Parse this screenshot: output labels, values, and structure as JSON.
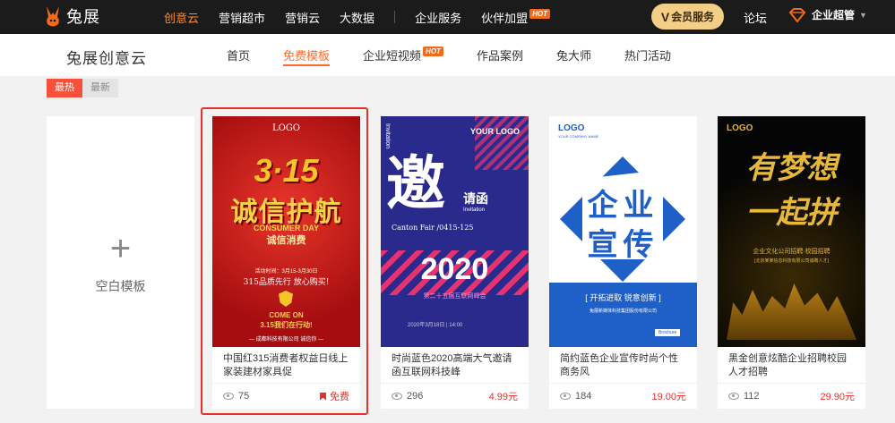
{
  "topbar": {
    "logo_text": "兔展",
    "nav": [
      {
        "label": "创意云",
        "active": true
      },
      {
        "label": "营销超市"
      },
      {
        "label": "营销云"
      },
      {
        "label": "大数据"
      }
    ],
    "nav2": [
      {
        "label": "企业服务"
      },
      {
        "label": "伙伴加盟",
        "hot": "HOT"
      }
    ],
    "vip_label": "会员服务",
    "vip_prefix": "V",
    "forum": "论坛",
    "enterprise": "企业超管"
  },
  "subbar": {
    "brand": "兔展创意云",
    "nav": [
      {
        "label": "首页"
      },
      {
        "label": "免费模板",
        "active": true
      },
      {
        "label": "企业短视频",
        "hot": "HOT"
      },
      {
        "label": "作品案例"
      },
      {
        "label": "兔大师"
      },
      {
        "label": "热门活动"
      }
    ]
  },
  "filters": [
    "最热",
    "最新"
  ],
  "blank_card": {
    "label": "空白模板"
  },
  "cards": [
    {
      "title": "中国红315消费者权益日线上家装建材家具促",
      "views": "75",
      "price": "免费",
      "free": true
    },
    {
      "title": "时尚蓝色2020高端大气邀请函互联网科技峰",
      "views": "296",
      "price": "4.99元"
    },
    {
      "title": "简约蓝色企业宣传时尚个性商务风",
      "views": "184",
      "price": "19.00元"
    },
    {
      "title": "黑金创意炫酷企业招聘校园人才招聘",
      "views": "112",
      "price": "29.90元"
    }
  ],
  "thumbs": {
    "t1": {
      "logo": "LOGO",
      "big": "3·15",
      "headline": "诚信护航",
      "sub": "CONSUMER DAY",
      "sub2": "诚信消费",
      "date": "活动时间：3月15-3月30日",
      "slogan": "315品质先行 放心购买!",
      "badge": "COME ON",
      "badge2": "3.15我们在行动!",
      "footer": "— 成都科技有限公司 诚信你 —"
    },
    "t2": {
      "label": "Invitation",
      "logo": "YOUR LOGO",
      "big": "邀",
      "small": "请函",
      "inv": "Invitation",
      "line": "Canton Fair /0415-125",
      "year": "2020",
      "strip": "第二十五届互联网峰会",
      "info": "2020年3月18日 | 14:00"
    },
    "t3": {
      "logo": "LOGO",
      "logo_sub": "YOUR COMPANY NAME",
      "word1": "企业",
      "word2": "宣传",
      "slogan": "[ 开拓进取 锐意创新 ]",
      "company": "兔展新媒体科技集团股份有限公司",
      "btn": "Brochure"
    },
    "t4": {
      "logo": "LOGO",
      "big1": "有梦想",
      "big2": "一起拼",
      "sub": "企业文化公司招聘·校园招聘",
      "sub2": "[北京某某信息科技有限公司诚聘人才]"
    }
  },
  "colors": {
    "accent": "#ff6a2b",
    "price": "#e8302a",
    "vip": "#f3cf86",
    "dark": "#1b1b1b"
  }
}
